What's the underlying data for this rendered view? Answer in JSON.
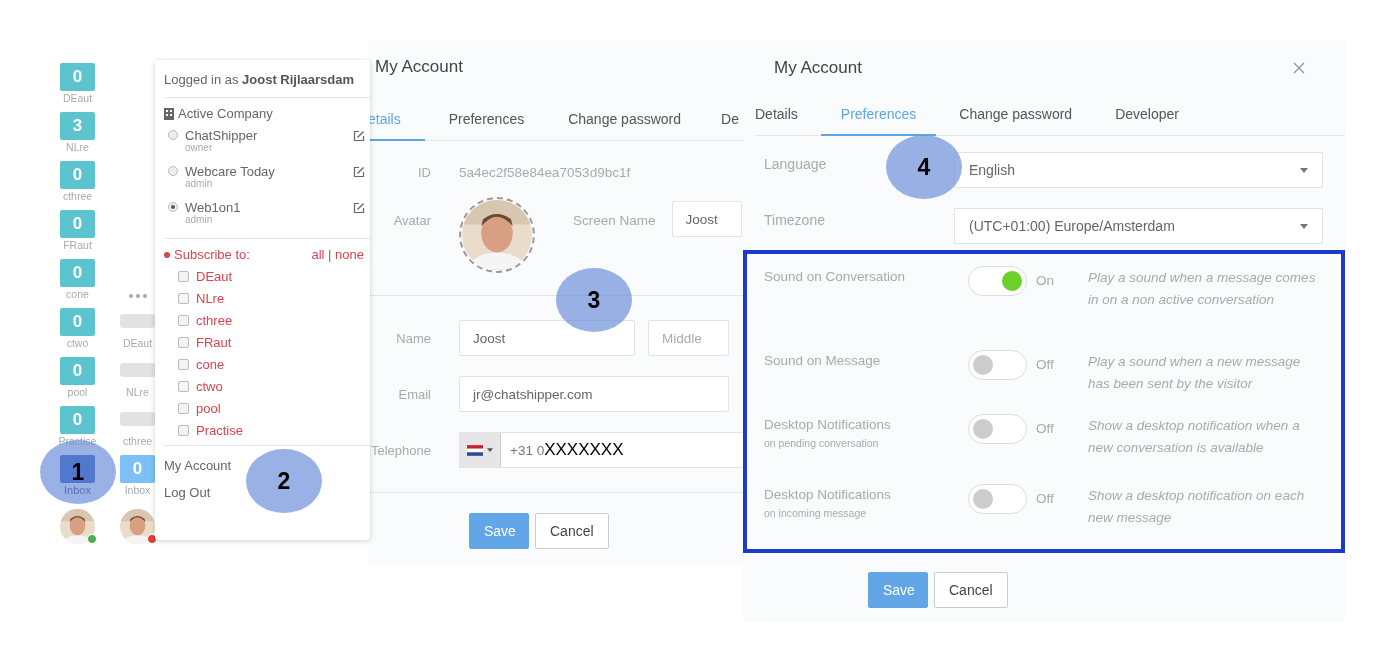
{
  "queue_sidebar": {
    "columns": [
      {
        "queues": [
          {
            "kind": "count",
            "count": "0",
            "label": "DEaut",
            "selected": false
          },
          {
            "kind": "count",
            "count": "3",
            "label": "NLre",
            "selected": false
          },
          {
            "kind": "count",
            "count": "0",
            "label": "cthree",
            "selected": false
          },
          {
            "kind": "count",
            "count": "0",
            "label": "FRaut",
            "selected": false
          },
          {
            "kind": "count",
            "count": "0",
            "label": "cone",
            "selected": false
          },
          {
            "kind": "count",
            "count": "0",
            "label": "ctwo",
            "selected": false
          },
          {
            "kind": "count",
            "count": "0",
            "label": "pool",
            "selected": false
          },
          {
            "kind": "count",
            "count": "0",
            "label": "Practise",
            "selected": false
          },
          {
            "kind": "inbox",
            "label": "Inbox",
            "selected": true
          }
        ],
        "status": {
          "color": "#4caf50"
        }
      },
      {
        "queues": [
          {
            "kind": "more"
          },
          {
            "kind": "loading",
            "label": "DEaut"
          },
          {
            "kind": "loading",
            "label": "NLre"
          },
          {
            "kind": "loading",
            "label": "cthree"
          },
          {
            "kind": "inbox",
            "count": "0",
            "label": "Inbox",
            "selected": false
          }
        ],
        "status": {
          "color": "#e53935"
        }
      }
    ]
  },
  "user_menu": {
    "logged_in": "Logged in as **Joost Rijlaarsdam**",
    "active_company_heading": "Active Company",
    "companies": [
      {
        "name": "ChatShipper",
        "role": "owner",
        "selected": false
      },
      {
        "name": "Webcare Today",
        "role": "admin",
        "selected": false
      },
      {
        "name": "Web1on1",
        "role": "admin",
        "selected": true
      }
    ],
    "subscribe_heading": "Subscribe to:",
    "subscribe_toggle": "all | none",
    "subscriptions": [
      {
        "name": "DEaut",
        "checked": false
      },
      {
        "name": "NLre",
        "checked": false
      },
      {
        "name": "cthree",
        "checked": false
      },
      {
        "name": "FRaut",
        "checked": false
      },
      {
        "name": "cone",
        "checked": false
      },
      {
        "name": "ctwo",
        "checked": false
      },
      {
        "name": "pool",
        "checked": false
      },
      {
        "name": "Practise",
        "checked": false
      }
    ],
    "items": [
      "My Account",
      "Log Out"
    ]
  },
  "details_dialog": {
    "title": "My Account",
    "tabs": [
      {
        "label": "etails",
        "selected": true
      },
      {
        "label": "Preferences",
        "selected": false
      },
      {
        "label": "Change password",
        "selected": false
      },
      {
        "label": "De",
        "selected": false
      }
    ],
    "id": {
      "label": "ID",
      "value": "5a4ec2f58e84ea7053d9bc1f"
    },
    "avatar": {
      "label": "Avatar"
    },
    "screen_name": {
      "label": "Screen Name",
      "value": "Joost"
    },
    "name": {
      "label": "Name",
      "value": "Joost",
      "middle_placeholder": "Middle"
    },
    "email": {
      "label": "Email",
      "value": "jr@chatshipper.com"
    },
    "telephone": {
      "label": "Telephone",
      "value": "+31 0",
      "redaction": "XXXXXXX"
    },
    "buttons": [
      "Save",
      "Cancel"
    ]
  },
  "preferences_dialog": {
    "title": "My Account",
    "tabs": [
      {
        "label": "Details",
        "selected": false
      },
      {
        "label": "Preferences",
        "selected": true
      },
      {
        "label": "Change password",
        "selected": false
      },
      {
        "label": "Developer",
        "selected": false
      }
    ],
    "language": {
      "label": "Language",
      "value": "English"
    },
    "timezone": {
      "label": "Timezone",
      "value": "(UTC+01:00) Europe/Amsterdam"
    },
    "settings": [
      {
        "label": "Sound on Conversation",
        "on": true,
        "state": "On",
        "description": "Play a sound when a message comes in on a non active conversation"
      },
      {
        "label": "Sound on Message",
        "on": false,
        "state": "Off",
        "description": "Play a sound when a new message has been sent by the visitor"
      },
      {
        "label": "Desktop Notifications",
        "sublabel": "on pending conversation",
        "on": false,
        "state": "Off",
        "description": "Show a desktop notification when a new conversation is available"
      },
      {
        "label": "Desktop Notifications",
        "sublabel": "on incoming message",
        "on": false,
        "state": "Off",
        "description": "Show a desktop notification on each new message"
      }
    ],
    "buttons": [
      "Save",
      "Cancel"
    ]
  },
  "callouts": [
    "1",
    "2",
    "3",
    "4"
  ]
}
